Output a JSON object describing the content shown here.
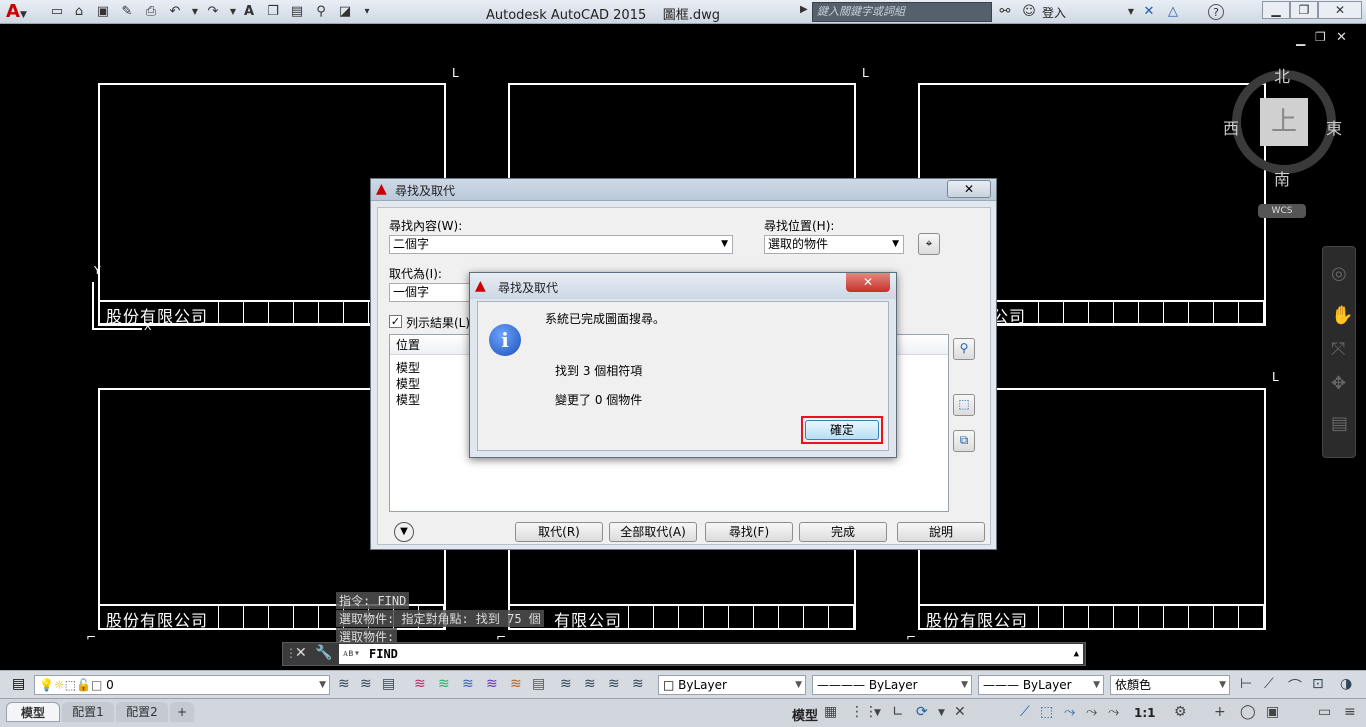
{
  "app": {
    "title": "Autodesk AutoCAD 2015    圖框.dwg",
    "search_placeholder": "鍵入關鍵字或詞組",
    "login_label": "登入"
  },
  "drawing": {
    "company_name": "股份有限公司",
    "company_name_partial_left": "公司",
    "company_name_partial_right": "有限公司",
    "viewcube": {
      "top_face": "上",
      "north": "北",
      "south": "南",
      "east": "東",
      "west": "西",
      "wcs": "WCS"
    }
  },
  "find_dialog": {
    "title": "尋找及取代",
    "find_label": "尋找內容(W):",
    "find_value": "二個字",
    "find_where_label": "尋找位置(H):",
    "find_where_value": "選取的物件",
    "replace_label": "取代為(I):",
    "replace_value": "一個字",
    "list_results_label": "列示結果(L)",
    "list_results_checked": true,
    "results_header": "位置",
    "results": [
      "模型",
      "模型",
      "模型"
    ],
    "buttons": {
      "replace": "取代(R)",
      "replace_all": "全部取代(A)",
      "find": "尋找(F)",
      "done": "完成",
      "help": "說明"
    }
  },
  "message_box": {
    "title": "尋找及取代",
    "line1": "系統已完成圖面搜尋。",
    "line2": "找到 3 個相符項",
    "line3": "變更了 0 個物件",
    "ok_label": "確定"
  },
  "command_history": [
    "指令: FIND",
    "選取物件: 指定對角點: 找到 75 個",
    "選取物件:"
  ],
  "command_line": {
    "value": "FIND"
  },
  "layer_toolbar": {
    "layer": "0",
    "color": "ByLayer",
    "linetype": "ByLayer",
    "lineweight": "ByLayer",
    "plotstyle": "依顏色"
  },
  "status_bar": {
    "tabs": [
      "模型",
      "配置1",
      "配置2"
    ],
    "mode": "模型",
    "scale": "1:1"
  },
  "colors": {
    "highlight_red": "#e8141c",
    "acad_red": "#c00000"
  }
}
